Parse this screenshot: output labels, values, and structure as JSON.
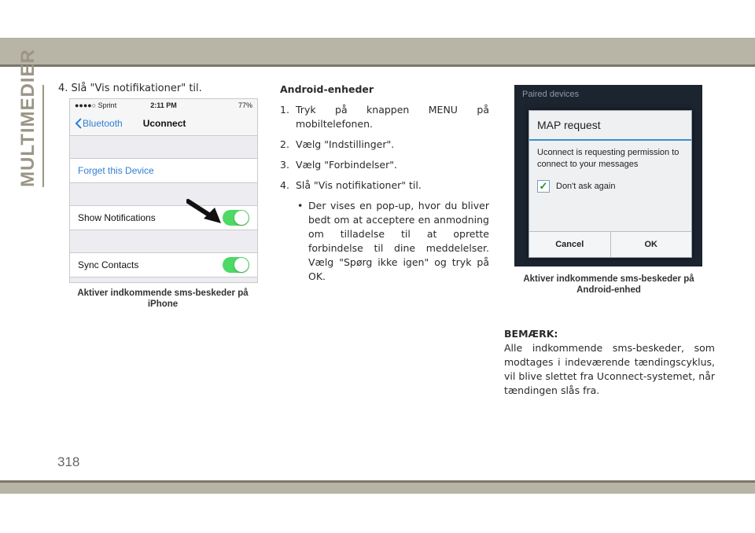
{
  "section_title": "MULTIMEDIER",
  "page_number": "318",
  "left_column": {
    "step_number": "4.",
    "step_text": "Slå \"Vis notifikationer\" til."
  },
  "iphone_screen": {
    "status_carrier": "●●●●○ Sprint",
    "status_time": "2:11 PM",
    "status_battery": "77%",
    "back_label": "Bluetooth",
    "title": "Uconnect",
    "forget_label": "Forget this Device",
    "show_notifications_label": "Show Notifications",
    "sync_contacts_label": "Sync Contacts"
  },
  "iphone_caption": "Aktiver indkommende sms-beskeder på iPhone",
  "android_section": {
    "heading": "Android-enheder",
    "steps": [
      {
        "number": "1.",
        "text": "Tryk på knappen MENU på mobiltelefonen."
      },
      {
        "number": "2.",
        "text": "Vælg \"Indstillinger\"."
      },
      {
        "number": "3.",
        "text": "Vælg \"Forbindelser\"."
      },
      {
        "number": "4.",
        "text": "Slå \"Vis notifikationer\" til."
      }
    ],
    "bullet": "Der vises en pop-up, hvor du bliver bedt om at acceptere en anmodning om tilladelse til at oprette forbindelse til dine meddelelser. Vælg \"Spørg ikke igen\" og tryk på OK."
  },
  "android_screen": {
    "paired_label": "Paired devices",
    "dialog_title": "MAP request",
    "dialog_message": "Uconnect is requesting permission to connect to your messages",
    "checkbox_label": "Don't ask again",
    "cancel_label": "Cancel",
    "ok_label": "OK"
  },
  "android_caption": "Aktiver indkommende sms-beskeder på Android-enhed",
  "note": {
    "heading": "BEMÆRK:",
    "text": "Alle indkommende sms-beskeder, som modtages i indeværende tændingscyklus, vil blive slettet fra Uconnect-systemet, når tændingen slås fra."
  },
  "colors": {
    "band": "#b8b4a6",
    "ios_blue": "#2f7fd4",
    "ios_green": "#4cd964",
    "android_bg": "#1c2430"
  }
}
